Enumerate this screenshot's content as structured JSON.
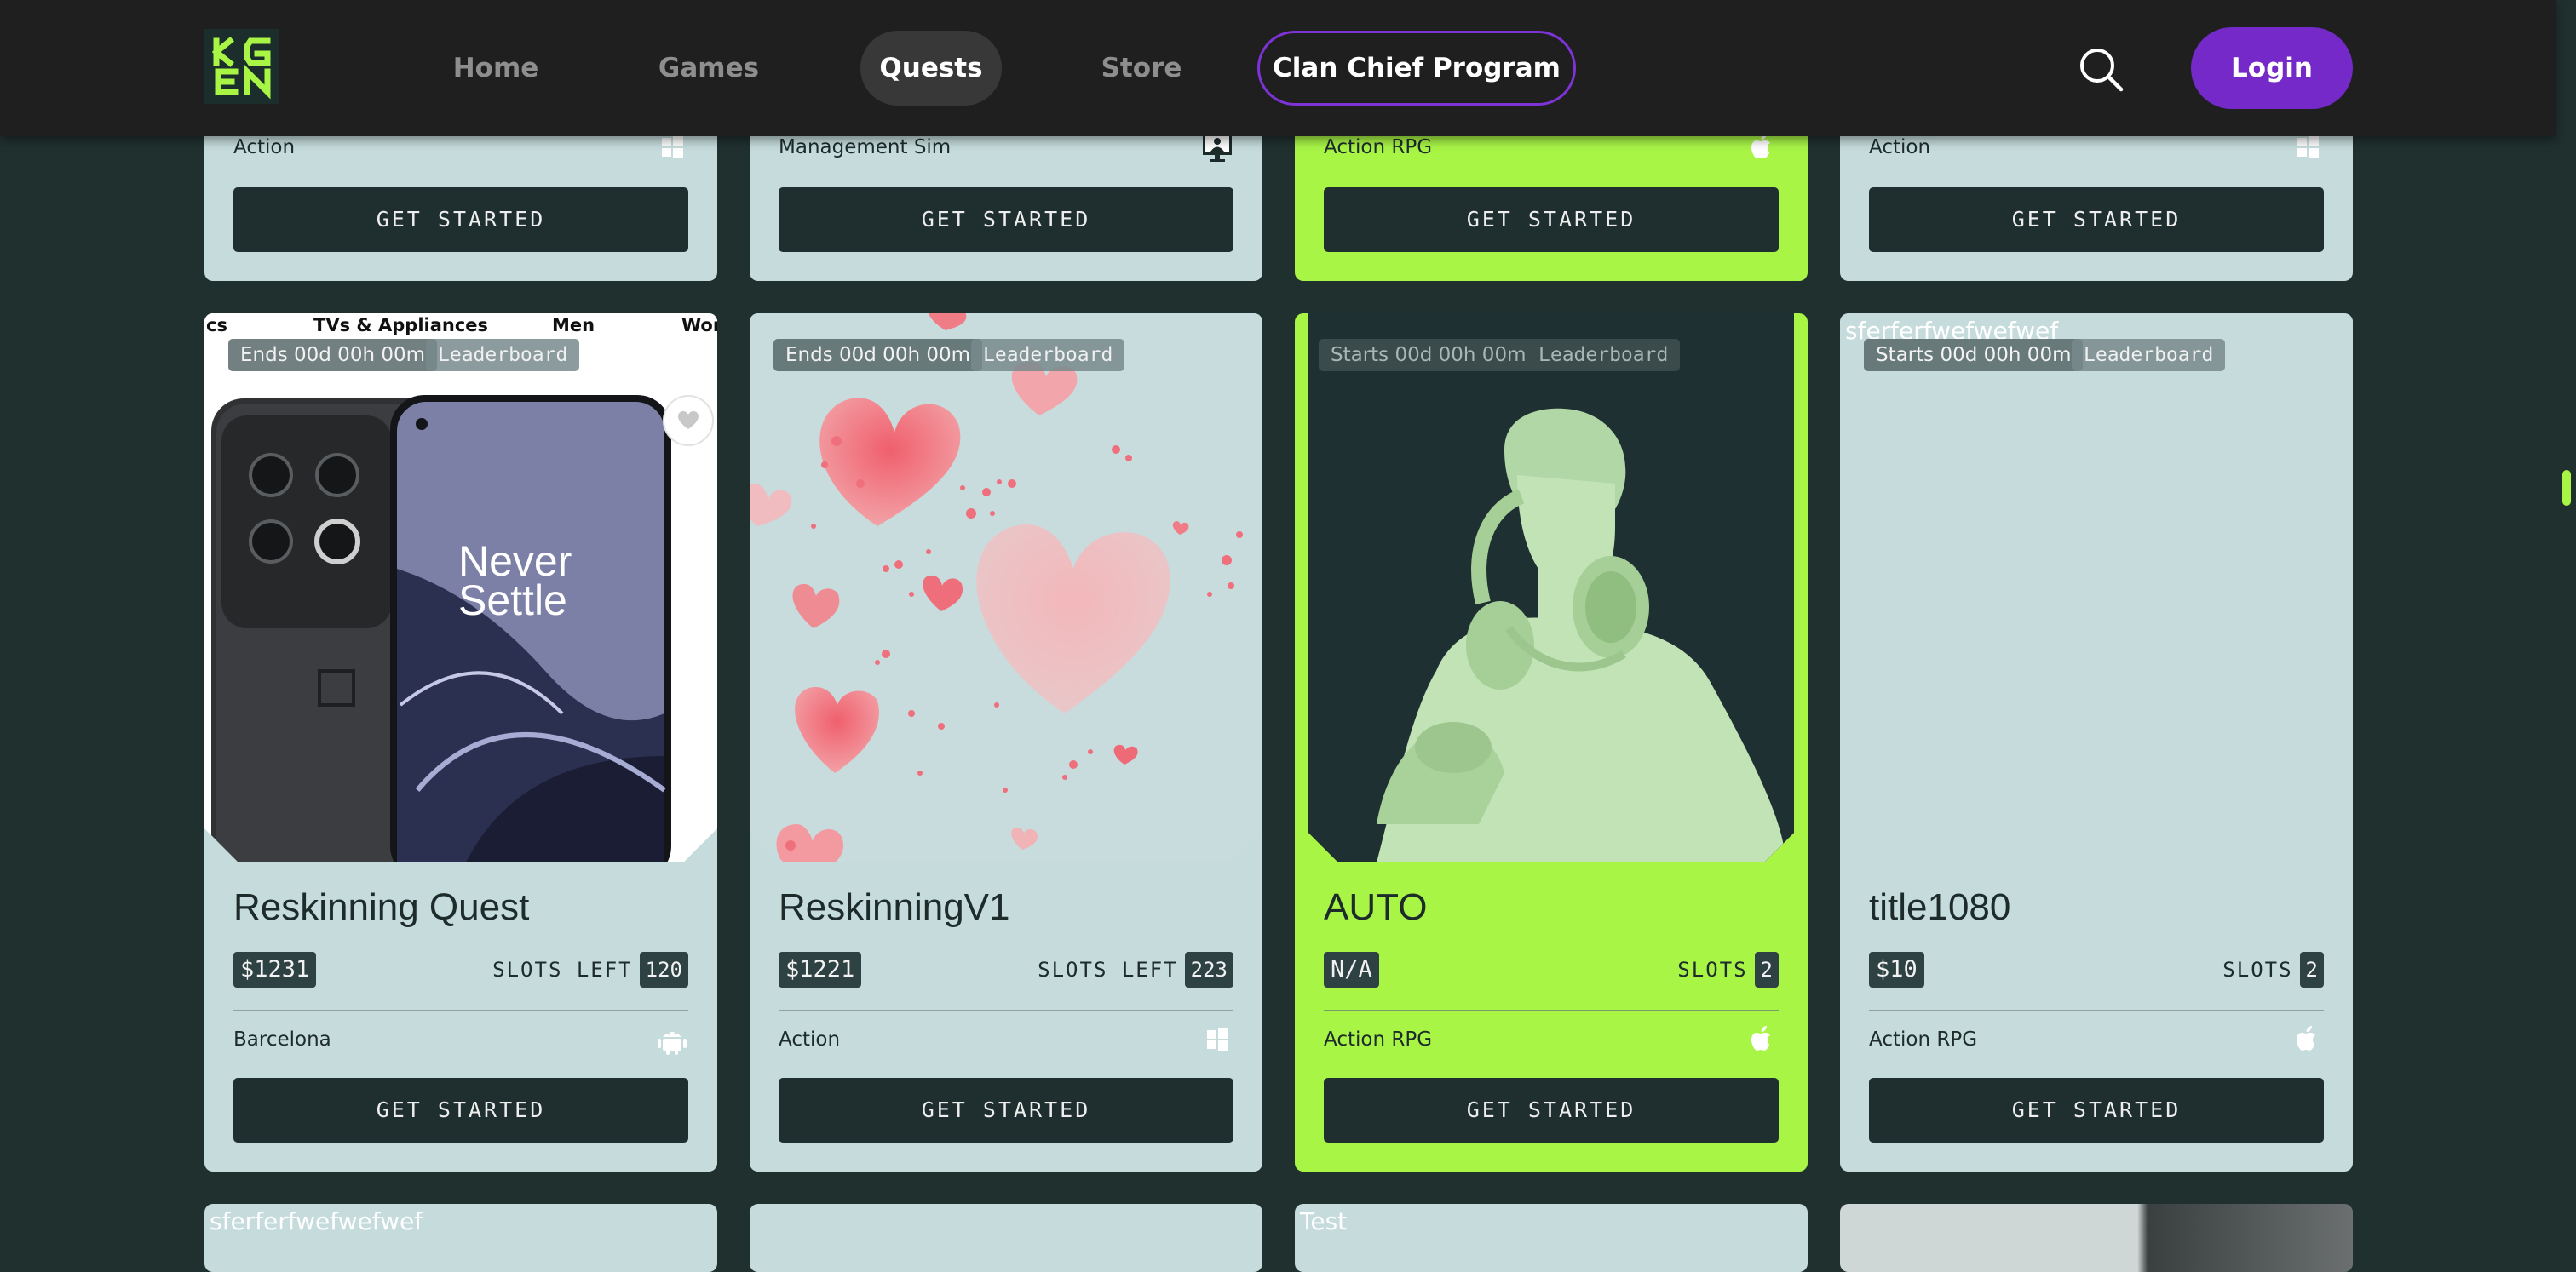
{
  "nav": {
    "logo_text": "KGEN",
    "links": [
      "Home",
      "Games",
      "Quests",
      "Store"
    ],
    "cta": "Clan Chief Program",
    "login": "Login",
    "accent": "#7429c8",
    "highlight": "#a8f546"
  },
  "top_cards": [
    {
      "genre": "Action",
      "platform": "windows-icon",
      "cta": "GET STARTED"
    },
    {
      "genre": "Management Sim",
      "platform": "desktop-user-icon",
      "cta": "GET STARTED"
    },
    {
      "genre": "Action RPG",
      "platform": "apple-icon",
      "cta": "GET STARTED",
      "featured": true
    },
    {
      "genre": "Action",
      "platform": "windows-icon",
      "cta": "GET STARTED"
    }
  ],
  "cards": [
    {
      "status": "Ends 00d 00h 00m",
      "badge": "Leaderboard",
      "title": "Reskinning Quest",
      "price": "$1231",
      "slots_label": "SLOTS LEFT",
      "slots": "120",
      "genre": "Barcelona",
      "platform": "android-icon",
      "cta": "GET STARTED",
      "image": {
        "menu": [
          "cs",
          "TVs & Appliances",
          "Men",
          "Won"
        ],
        "tagline_1": "Never",
        "tagline_2": "Settle"
      }
    },
    {
      "status": "Ends 00d 00h 00m",
      "badge": "Leaderboard",
      "title": "ReskinningV1",
      "price": "$1221",
      "slots_label": "SLOTS LEFT",
      "slots": "223",
      "genre": "Action",
      "platform": "windows-icon",
      "cta": "GET STARTED"
    },
    {
      "status": "Starts 00d 00h 00m",
      "badge": "Leaderboard",
      "title": "AUTO",
      "price": "N/A",
      "slots_label": "SLOTS",
      "slots": "2",
      "genre": "Action RPG",
      "platform": "apple-icon",
      "cta": "GET STARTED",
      "featured": true
    },
    {
      "status": "Starts 00d 00h 00m",
      "badge": "Leaderboard",
      "title": "title1080",
      "price": "$10",
      "slots_label": "SLOTS",
      "slots": "2",
      "genre": "Action RPG",
      "platform": "apple-icon",
      "cta": "GET STARTED",
      "broken_image_alt": "sferferfwefwefwef"
    }
  ],
  "next_row": [
    "sferferfwefwefwef",
    "",
    "Test",
    ""
  ]
}
